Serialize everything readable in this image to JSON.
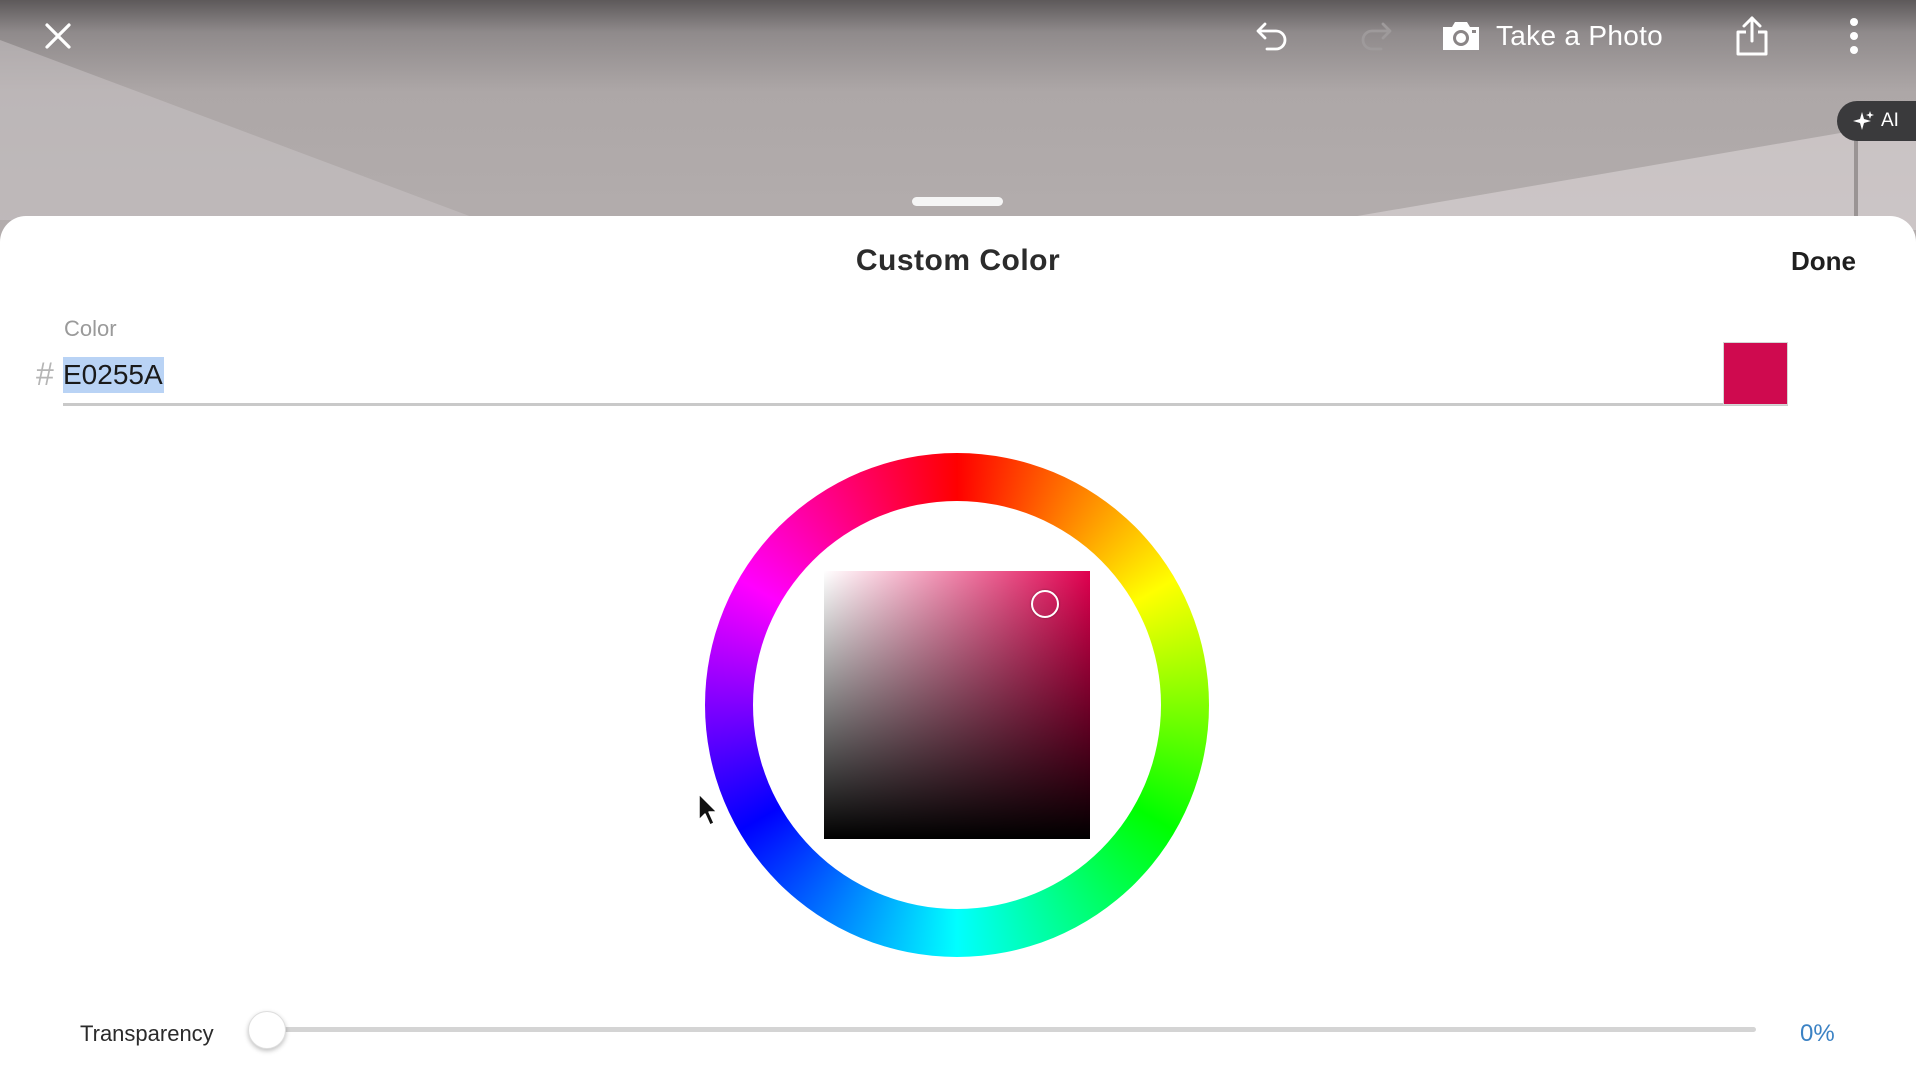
{
  "toolbar": {
    "close_icon": "close-icon",
    "undo_icon": "undo-icon",
    "redo_icon": "redo-icon",
    "camera_icon": "camera-icon",
    "take_photo_label": "Take a Photo",
    "share_icon": "share-icon",
    "more_icon": "more-vertical-icon",
    "ai_label": "AI"
  },
  "sheet": {
    "title": "Custom Color",
    "done_label": "Done"
  },
  "color": {
    "label": "Color",
    "hash": "#",
    "hex_value": "E0255A",
    "swatch_color": "#cf0a4f"
  },
  "transparency": {
    "label": "Transparency",
    "value_label": "0%",
    "value": 0
  },
  "colors": {
    "accent": "#3b82c4",
    "selection": "#b9d3f5"
  }
}
